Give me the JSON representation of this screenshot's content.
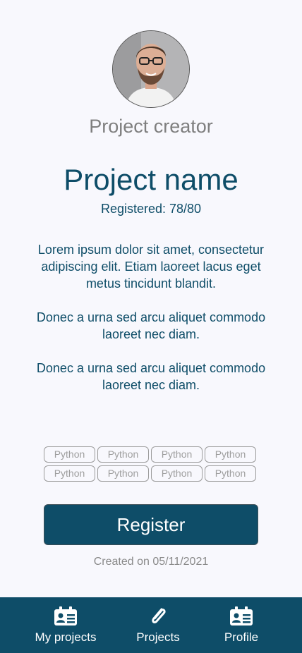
{
  "creator": {
    "label": "Project creator",
    "avatar_icon": "user-photo"
  },
  "project": {
    "name": "Project name",
    "registered": "Registered: 78/80",
    "description": [
      "Lorem ipsum dolor sit amet, consectetur adipiscing elit. Etiam laoreet lacus eget metus tincidunt blandit.",
      "Donec a urna sed arcu aliquet commodo laoreet nec diam.",
      "Donec a urna sed arcu aliquet commodo laoreet nec diam."
    ],
    "tags": [
      "Python",
      "Python",
      "Python",
      "Python",
      "Python",
      "Python",
      "Python",
      "Python"
    ],
    "created": "Created on 05/11/2021"
  },
  "actions": {
    "register_label": "Register"
  },
  "nav": {
    "items": [
      {
        "label": "My projects",
        "icon": "id-card-icon"
      },
      {
        "label": "Projects",
        "icon": "paperclip-icon"
      },
      {
        "label": "Profile",
        "icon": "id-card-icon"
      }
    ]
  },
  "colors": {
    "primary": "#0e4d68",
    "background": "#f8f8fd",
    "muted_text": "#7f7f7f"
  }
}
